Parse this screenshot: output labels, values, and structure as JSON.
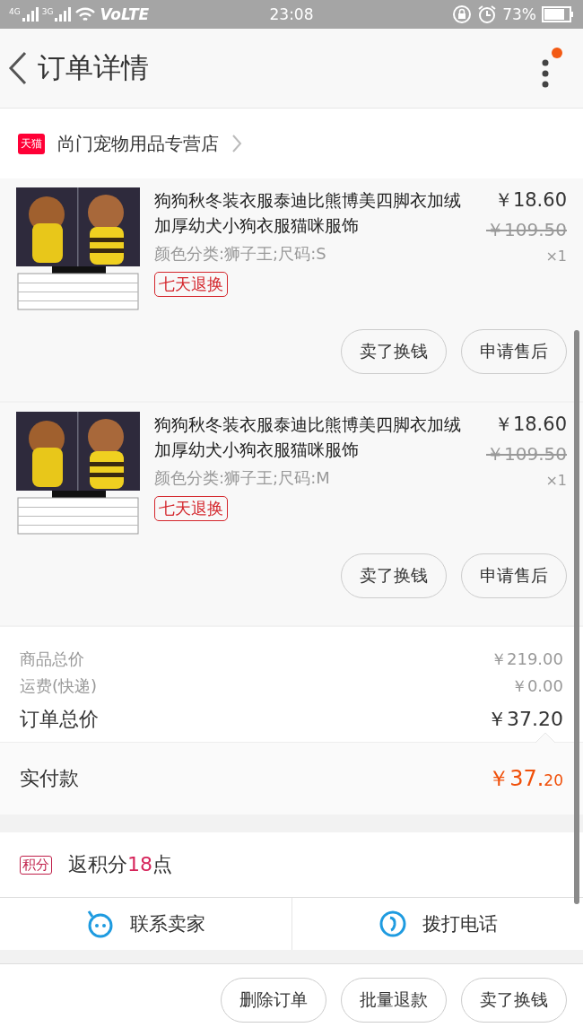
{
  "status_bar": {
    "network_1": "4G",
    "network_2": "3G",
    "volte": "VoLTE",
    "time": "23:08",
    "battery": "73%"
  },
  "header": {
    "title": "订单详情"
  },
  "shop": {
    "badge": "天猫",
    "name": "尚门宠物用品专营店"
  },
  "items": [
    {
      "title": "狗狗秋冬装衣服泰迪比熊博美四脚衣加绒加厚幼犬小狗衣服猫咪服饰",
      "price": "￥18.60",
      "original_price": "￥109.50",
      "spec": "颜色分类:狮子王;尺码:S",
      "tag": "七天退换",
      "quantity": "×1",
      "buttons": [
        "卖了换钱",
        "申请售后"
      ]
    },
    {
      "title": "狗狗秋冬装衣服泰迪比熊博美四脚衣加绒加厚幼犬小狗衣服猫咪服饰",
      "price": "￥18.60",
      "original_price": "￥109.50",
      "spec": "颜色分类:狮子王;尺码:M",
      "tag": "七天退换",
      "quantity": "×1",
      "buttons": [
        "卖了换钱",
        "申请售后"
      ]
    }
  ],
  "summary": [
    {
      "kind": "minor",
      "label": "商品总价",
      "value": "￥219.00"
    },
    {
      "kind": "minor",
      "label": "运费(快递)",
      "value": "￥0.00"
    },
    {
      "kind": "major",
      "label": "订单总价",
      "value": "￥37.20"
    }
  ],
  "paid": {
    "label": "实付款",
    "value": "￥37.",
    "cents": "20"
  },
  "points": {
    "badge": "积分",
    "text": "返积分",
    "count": "18",
    "unit": "点"
  },
  "contact": [
    {
      "kind": "chat",
      "label": "联系卖家"
    },
    {
      "kind": "phone",
      "label": "拨打电话"
    }
  ],
  "bottom_buttons": [
    "删除订单",
    "批量退款",
    "卖了换钱"
  ]
}
